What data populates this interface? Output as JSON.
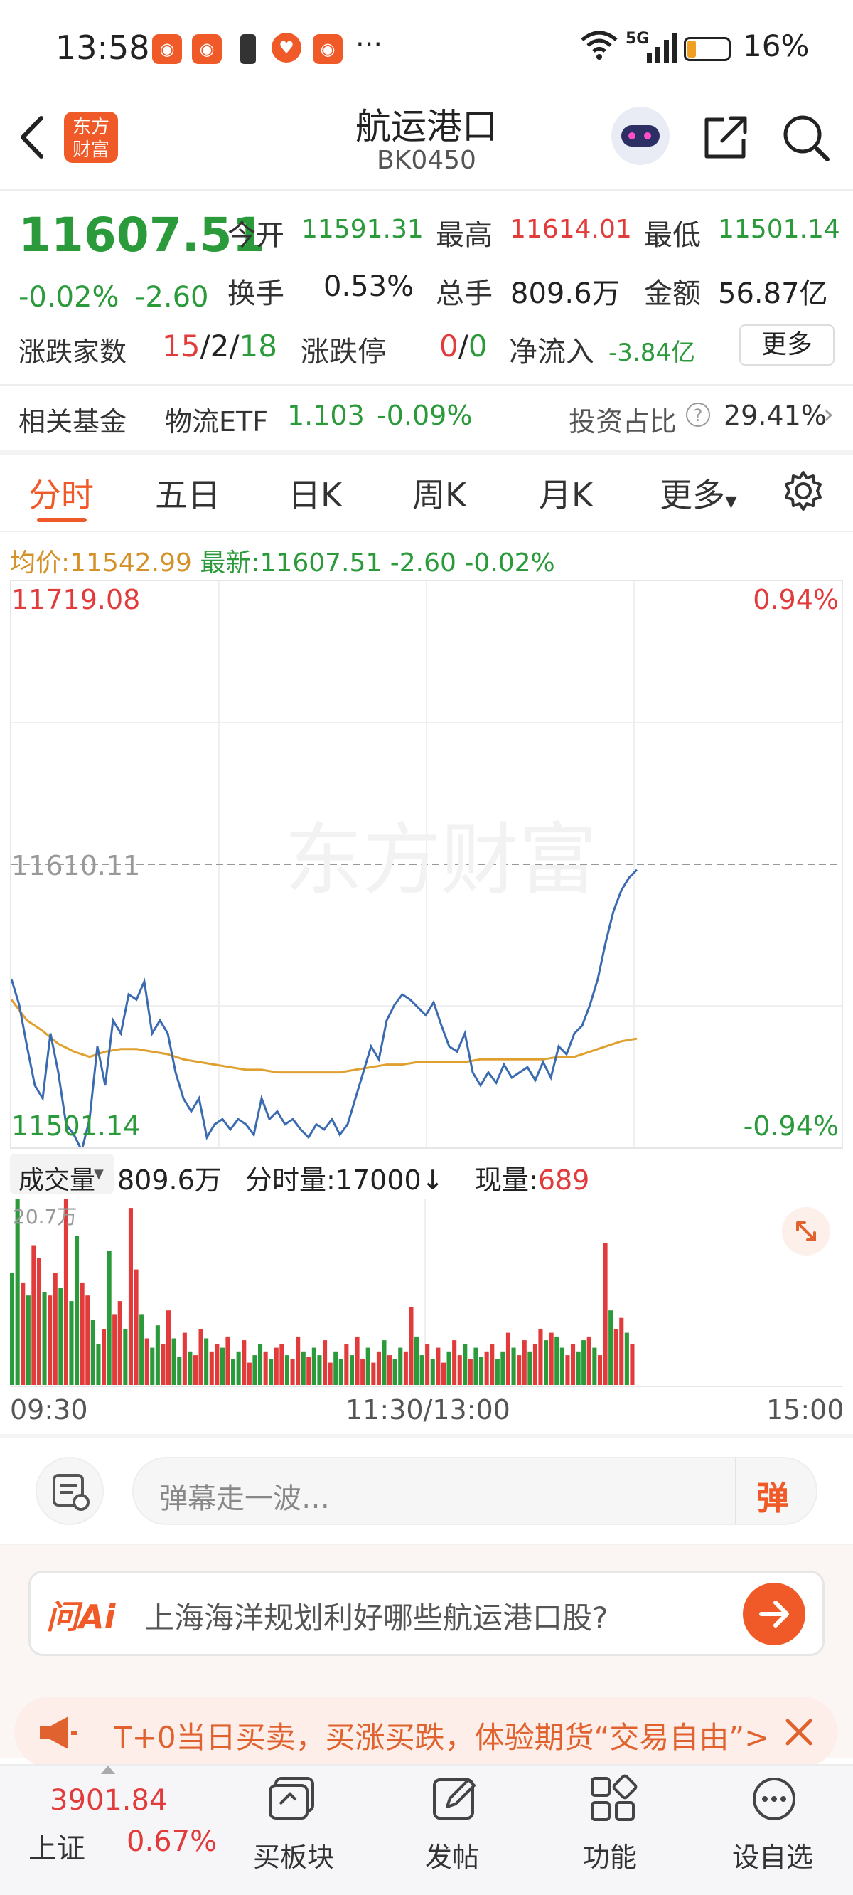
{
  "status_bar": {
    "time": "13:58",
    "dots": "···",
    "network": "5G",
    "battery": "16%"
  },
  "header": {
    "back_icon": "chevron-left-icon",
    "logo_text_line1": "东方",
    "logo_text_line2": "财富",
    "title": "航运港口",
    "code": "BK0450",
    "icons": [
      "robot-icon",
      "share-icon",
      "search-icon"
    ]
  },
  "quote": {
    "price": "11607.51",
    "change_pct": "-0.02%",
    "change": "-2.60",
    "open_label": "今开",
    "open": "11591.31",
    "high_label": "最高",
    "high": "11614.01",
    "low_label": "最低",
    "low": "11501.14",
    "turnover_label": "换手",
    "turnover": "0.53%",
    "volume_label": "总手",
    "volume": "809.6万",
    "amount_label": "金额",
    "amount": "56.87亿",
    "updown_label": "涨跌家数",
    "up_count": "15",
    "sep1": "/",
    "flat_count": "2",
    "sep2": "/",
    "down_count": "18",
    "limit_label": "涨跌停",
    "limit_up": "0",
    "sep3": "/",
    "limit_down": "0",
    "inflow_label": "净流入",
    "inflow": "-3.84亿",
    "more_button": "更多"
  },
  "fund": {
    "label": "相关基金",
    "name": "物流ETF",
    "price": "1.103",
    "change": "-0.09%",
    "ratio_label": "投资占比",
    "ratio": "29.41%"
  },
  "tabs": [
    {
      "label": "分时",
      "active": true
    },
    {
      "label": "五日"
    },
    {
      "label": "日K"
    },
    {
      "label": "周K"
    },
    {
      "label": "月K"
    },
    {
      "label": "更多"
    }
  ],
  "info_line": {
    "avg_label": "均价:",
    "avg": "11542.99",
    "latest_label": "最新:",
    "latest": "11607.51",
    "change": "-2.60",
    "change_pct": "-0.02%"
  },
  "chart_data": {
    "type": "line",
    "y_max_label": "11719.08",
    "y_max_pct": "0.94%",
    "prev_close_label": "11610.11",
    "y_min_label": "11501.14",
    "y_min_pct": "-0.94%",
    "ylim": [
      11501.14,
      11719.08
    ],
    "prev_close": 11610.11,
    "watermark": "东方财富",
    "series": [
      {
        "values": [
          11566,
          11556,
          11540,
          11525,
          11520,
          11545,
          11530,
          11510,
          11506,
          11500,
          11512,
          11540,
          11525,
          11550,
          11545,
          11560,
          11558,
          11565,
          11545,
          11550,
          11545,
          11530,
          11520,
          11515,
          11520,
          11505,
          11510,
          11512,
          11508,
          11512,
          11510,
          11506,
          11520,
          11512,
          11515,
          11510,
          11512,
          11508,
          11505,
          11510,
          11508,
          11512,
          11506,
          11510,
          11520,
          11530,
          11540,
          11535,
          11550,
          11556,
          11560,
          11558,
          11555,
          11552,
          11557,
          11548,
          11540,
          11538,
          11545,
          11530,
          11525,
          11530,
          11526,
          11533,
          11528,
          11530,
          11532,
          11527,
          11534,
          11528,
          11540,
          11537,
          11545,
          11548,
          11556,
          11566,
          11580,
          11592,
          11600,
          11605,
          11608
        ]
      },
      {
        "values": [
          11558,
          11550,
          11546,
          11541,
          11538,
          11536,
          11538,
          11539,
          11539,
          11538,
          11537,
          11535,
          11534,
          11533,
          11532,
          11531,
          11531,
          11530,
          11530,
          11530,
          11530,
          11530,
          11531,
          11532,
          11533,
          11533,
          11534,
          11534,
          11534,
          11534,
          11535,
          11535,
          11535,
          11535,
          11535,
          11536,
          11536,
          11538,
          11540,
          11542,
          11543
        ]
      }
    ]
  },
  "volume": {
    "label": "成交量",
    "total": "809.6万",
    "tick_label": "分时量:17000",
    "current_label": "现量:",
    "current": "689",
    "max_label": "20.7万",
    "values": [
      60,
      100,
      55,
      48,
      75,
      68,
      50,
      48,
      60,
      52,
      100,
      45,
      80,
      55,
      48,
      35,
      22,
      30,
      72,
      38,
      45,
      30,
      95,
      62,
      38,
      25,
      20,
      32,
      22,
      40,
      25,
      15,
      28,
      18,
      16,
      30,
      25,
      18,
      22,
      20,
      26,
      14,
      18,
      24,
      12,
      16,
      22,
      18,
      14,
      20,
      22,
      16,
      14,
      26,
      18,
      15,
      20,
      16,
      24,
      12,
      18,
      14,
      22,
      16,
      26,
      14,
      20,
      12,
      18,
      24,
      16,
      14,
      20,
      18,
      42,
      26,
      16,
      22,
      14,
      20,
      12,
      18,
      24,
      16,
      22,
      14,
      20,
      15,
      18,
      22,
      14,
      18,
      28,
      20,
      16,
      24,
      18,
      22,
      30,
      24,
      28,
      26,
      20,
      16,
      22,
      18,
      24,
      26,
      20,
      16,
      76,
      40,
      30,
      36,
      28,
      22
    ],
    "times": [
      "09:30",
      "11:30/13:00",
      "15:00"
    ]
  },
  "danmu": {
    "placeholder": "弹幕走一波…",
    "send_label": "弹"
  },
  "ai_bar": {
    "logo": "问Ai",
    "text": "上海海洋规划利好哪些航运港口股?"
  },
  "promo": {
    "text": "T+0当日买卖，买涨买跌，体验期货“交易自由”>"
  },
  "bottom_nav": {
    "index_value": "3901.84",
    "index_name": "上证",
    "index_change": "0.67%",
    "items": [
      {
        "label": "买板块",
        "icon": "buy-block-icon"
      },
      {
        "label": "发帖",
        "icon": "edit-icon"
      },
      {
        "label": "功能",
        "icon": "grid-icon"
      },
      {
        "label": "设自选",
        "icon": "more-circle-icon"
      }
    ]
  },
  "colors": {
    "up": "#e23b3b",
    "down": "#2a9a3a",
    "brand": "#f05a28",
    "price_line": "#3a6ab0",
    "avg_line": "#e0a030"
  }
}
